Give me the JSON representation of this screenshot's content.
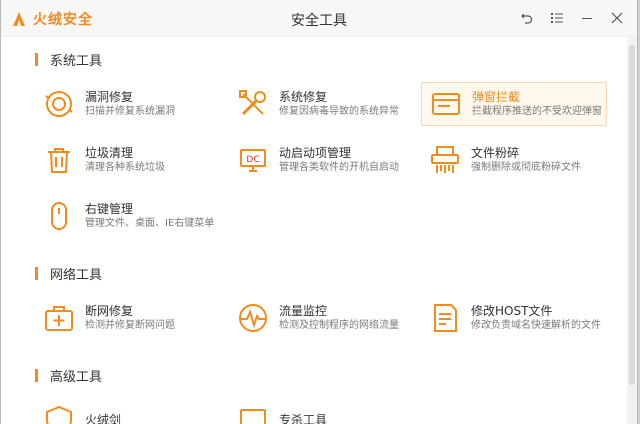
{
  "app": {
    "logo_text": "火绒安全",
    "title": "安全工具"
  },
  "window_controls": [
    "back-icon",
    "menu-icon",
    "minimize-icon",
    "close-icon"
  ],
  "colors": {
    "accent": "#f08c1e",
    "active_bg": "#fff8ed"
  },
  "sections": [
    {
      "label": "系统工具"
    },
    {
      "label": "网络工具"
    },
    {
      "label": "高级工具"
    }
  ],
  "tools": {
    "leak_fix": {
      "name": "漏洞修复",
      "desc": "扫描并修复系统漏洞",
      "icon": "vulnerability-icon"
    },
    "sys_repair": {
      "name": "系统修复",
      "desc": "修复因病毒导致的系统异常",
      "icon": "wrench-icon"
    },
    "popup_block": {
      "name": "弹窗拦截",
      "desc": "拦截程序推送的不受欢迎弹窗",
      "icon": "window-icon",
      "active": true
    },
    "junk_clean": {
      "name": "垃圾清理",
      "desc": "清理各种系统垃圾",
      "icon": "trash-icon"
    },
    "startup_mgr": {
      "name": "动启动项管理",
      "desc": "管理各类软件的开机自启动",
      "icon": "monitor-icon",
      "overlay": "DC"
    },
    "file_shred": {
      "name": "文件粉碎",
      "desc": "强制删除或彻底粉碎文件",
      "icon": "shredder-icon"
    },
    "right_click": {
      "name": "右键管理",
      "desc": "管理文件、桌面、IE右键菜单",
      "icon": "mouse-icon"
    },
    "net_repair": {
      "name": "断网修复",
      "desc": "检测并修复断网问题",
      "icon": "medical-kit-icon"
    },
    "traffic_mon": {
      "name": "流量监控",
      "desc": "检测及控制程序的网络流量",
      "icon": "pulse-icon"
    },
    "host_edit": {
      "name": "修改HOST文件",
      "desc": "修改负责域名快速解析的文件",
      "icon": "document-edit-icon"
    },
    "advanced_1": {
      "name": "火绒剑",
      "icon": "shield-icon"
    },
    "advanced_2": {
      "name": "专杀工具",
      "icon": "monitor-icon"
    }
  }
}
